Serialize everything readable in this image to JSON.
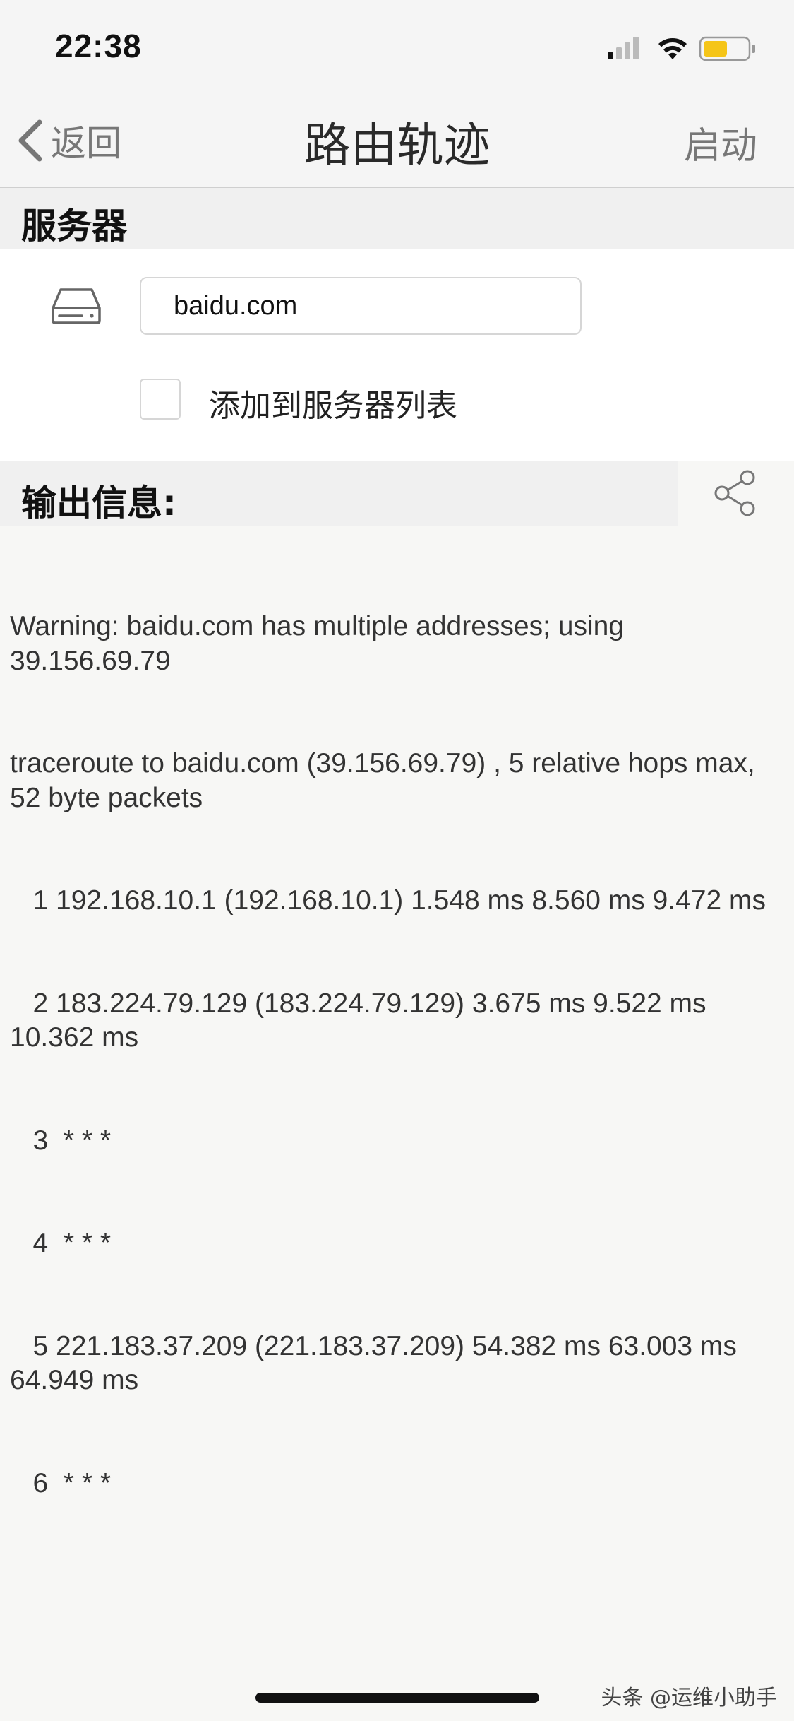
{
  "status_bar": {
    "time": "22:38",
    "icons": [
      "cellular-signal-icon",
      "wifi-icon",
      "battery-icon"
    ],
    "battery_color": "#f5c518"
  },
  "nav": {
    "back_label": "返回",
    "title": "路由轨迹",
    "start_label": "启动"
  },
  "server_section": {
    "title": "服务器",
    "icon": "drive-icon",
    "input_value": "baidu.com",
    "checkbox_label": "添加到服务器列表",
    "checkbox_checked": false
  },
  "output_section": {
    "title": "输出信息:",
    "share_icon": "share-icon",
    "lines": [
      "Warning: baidu.com has multiple addresses; using 39.156.69.79",
      "traceroute to baidu.com (39.156.69.79) , 5 relative hops max, 52 byte packets",
      "   1 192.168.10.1 (192.168.10.1) 1.548 ms 8.560 ms 9.472 ms",
      "   2 183.224.79.129 (183.224.79.129) 3.675 ms 9.522 ms 10.362 ms",
      "   3  * * *",
      "   4  * * *",
      "   5 221.183.37.209 (221.183.37.209) 54.382 ms 63.003 ms 64.949 ms",
      "   6  * * *"
    ]
  },
  "watermark": "头条 @运维小助手",
  "colors": {
    "background": "#f7f7f5",
    "header_bg": "#f0f0f0",
    "text": "#333333",
    "secondary_text": "#777777"
  }
}
